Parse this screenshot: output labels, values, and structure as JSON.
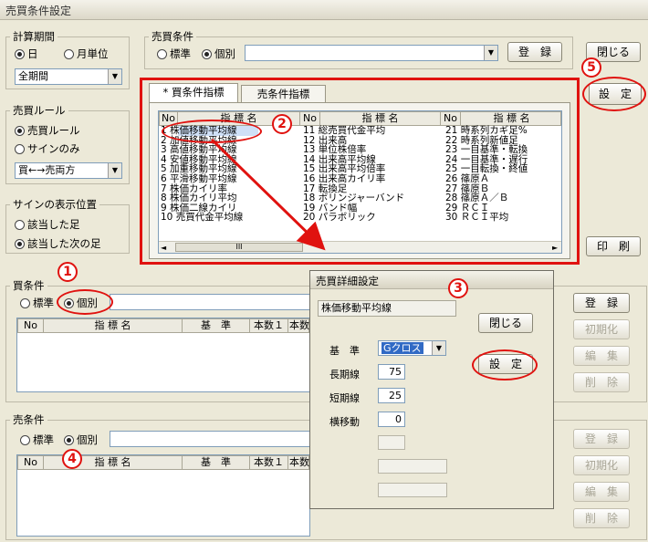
{
  "window": {
    "title": "売買条件設定"
  },
  "period": {
    "legend": "計算期間",
    "opt_day": "日",
    "opt_month": "月単位",
    "combo": "全期間"
  },
  "rule": {
    "legend": "売買ルール",
    "opt_rule": "売買ルール",
    "opt_sign": "サインのみ",
    "combo": "買←→売両方"
  },
  "signpos": {
    "legend": "サインの表示位置",
    "opt_hit": "該当した足",
    "opt_next": "該当した次の足"
  },
  "trade": {
    "legend": "売買条件",
    "opt_std": "標準",
    "opt_ind": "個別",
    "register": "登　録"
  },
  "close_button": "閉じる",
  "set_button": "設　定",
  "print_button": "印　刷",
  "tabs": {
    "buy": "* 買条件指標",
    "sell": "売条件指標"
  },
  "list": {
    "headers": {
      "no": "No",
      "name": "指 標 名"
    },
    "col1": [
      "1 株価移動平均線",
      "2 加値移動平均線",
      "3 高値移動平均線",
      "4 安値移動平均線",
      "5 加重移動平均線",
      "6 平滑移動平均線",
      "7 株価カイリ率",
      "8 株価カイリ平均",
      "9 株価二線カイリ",
      "10 売買代金平均線"
    ],
    "col2": [
      "11 総売買代金平均",
      "12 出来高",
      "13 単位株倍率",
      "14 出来高平均線",
      "15 出来高平均倍率",
      "16 出来高カイリ率",
      "17 転換足",
      "18 ボリンジャーバンド",
      "19 バンド幅",
      "20 パラボリック"
    ],
    "col3": [
      "21 時系列カギ足%",
      "22 時系列新値足",
      "23 一目基準・転換",
      "24 一目基準・遅行",
      "25 一目転換・終値",
      "26 篠原Ａ",
      "27 篠原Ｂ",
      "28 篠原Ａ／Ｂ",
      "29 ＲＣＩ",
      "30 ＲＣＩ平均"
    ],
    "scroll_thumb": "III"
  },
  "buy": {
    "legend": "買条件",
    "opt_std": "標準",
    "opt_ind": "個別",
    "headers": [
      "No",
      "指 標 名",
      "基　準",
      "本数１",
      "本数"
    ],
    "buttons": {
      "register": "登　録",
      "init": "初期化",
      "edit": "編　集",
      "delete": "削　除"
    }
  },
  "sell": {
    "legend": "売条件",
    "opt_std": "標準",
    "opt_ind": "個別",
    "headers": [
      "No",
      "指 標 名",
      "基　準",
      "本数１",
      "本数"
    ],
    "buttons": {
      "register": "登　録",
      "init": "初期化",
      "edit": "編　集",
      "delete": "削　除"
    }
  },
  "dialog": {
    "title": "売買詳細設定",
    "indicator": "株価移動平均線",
    "close": "閉じる",
    "set": "設　定",
    "base_label": "基　準",
    "base_value": "Gクロス",
    "long_label": "長期線",
    "long_value": "75",
    "short_label": "短期線",
    "short_value": "25",
    "shift_label": "横移動",
    "shift_value": "0"
  },
  "badges": {
    "b1": "1",
    "b2": "2",
    "b3": "3",
    "b4": "4",
    "b5": "5"
  },
  "colors": {
    "highlight": "#e0120f",
    "background": "#ece9d8",
    "select_blue": "#316ac5"
  }
}
